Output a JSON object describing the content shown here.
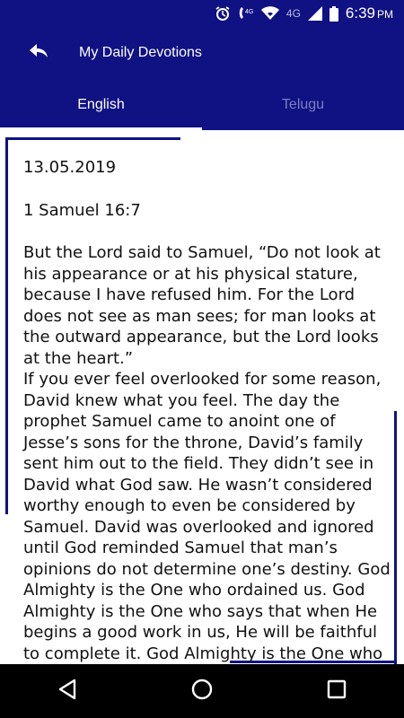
{
  "status_bar": {
    "time": "6:39",
    "period": "PM",
    "network_label": "4G",
    "volte_label": "4G",
    "icons": [
      "alarm-icon",
      "volte-icon",
      "wifi-icon",
      "signal-icon",
      "battery-icon"
    ]
  },
  "app_bar": {
    "title": "My Daily Devotions",
    "back_icon": "back-arrow-icon"
  },
  "tabs": [
    {
      "label": "English",
      "active": true
    },
    {
      "label": "Telugu",
      "active": false
    }
  ],
  "devotion": {
    "date": "13.05.2019",
    "reference": "1 Samuel 16:7",
    "verse": "But the Lord said to Samuel, “Do not look at his appearance or at his physical stature, because I have refused him. For the Lord does not see as man sees; for man looks at the outward appearance, but the Lord looks at the heart.”",
    "body": "If you ever feel overlooked for some reason, David knew what you feel. The day the prophet Samuel came to anoint one of Jesse’s sons for the throne, David’s family sent him out to the field. They didn’t see in David what God saw. He wasn’t considered worthy enough to even be considered by Samuel. David was overlooked and ignored until God reminded Samuel that man’s opinions do not determine one’s destiny. God Almighty is the One who ordained us. God Almighty is the One who says that when He begins a good work in us, He will be faithful to complete it. God Almighty is the One who"
  },
  "colors": {
    "primary": "#101183",
    "inactive_tab": "#7c7fc0",
    "nav_bar": "#000000"
  },
  "nav_bar": {
    "icons": [
      "back-triangle-icon",
      "home-circle-icon",
      "recents-square-icon"
    ]
  }
}
